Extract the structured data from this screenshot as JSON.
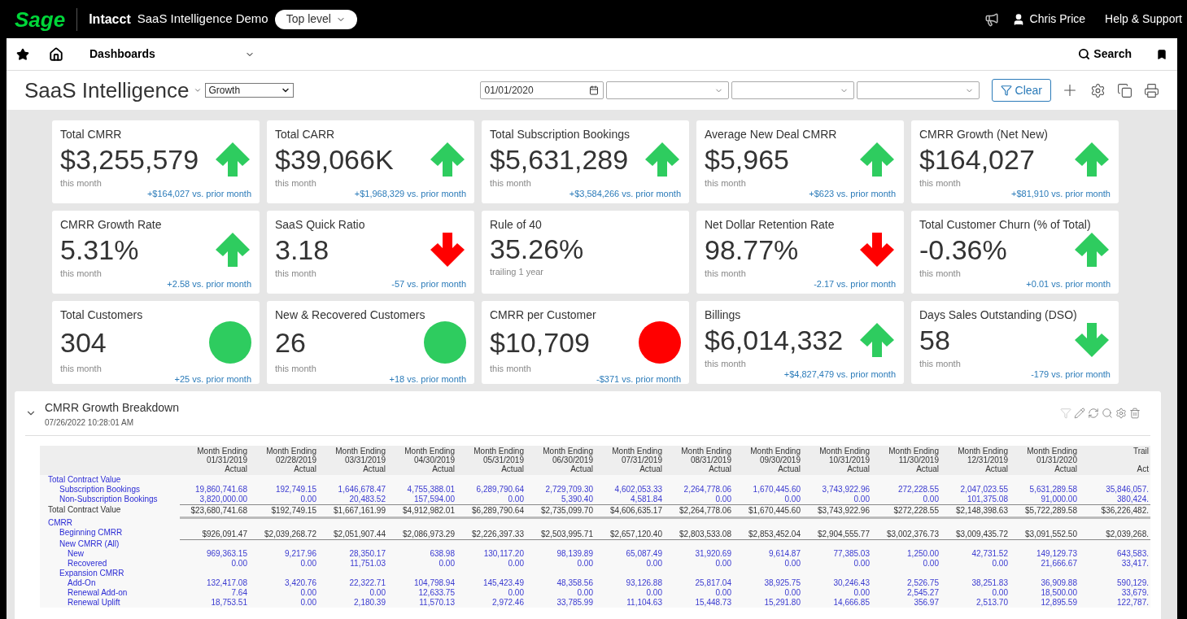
{
  "top_bar": {
    "logo": "Sage",
    "product": "Intacct",
    "company": "SaaS Intelligence Demo",
    "level_button": "Top level",
    "user": "Chris Price",
    "help": "Help & Support"
  },
  "nav": {
    "menu": "Dashboards",
    "search": "Search"
  },
  "title_bar": {
    "title": "SaaS Intelligence",
    "view": "Growth",
    "date": "01/01/2020",
    "clear_button": "Clear"
  },
  "cards": [
    {
      "title": "Total CMRR",
      "value": "$3,255,579",
      "subtitle": "this month",
      "comparison": "+$164,027 vs. prior month",
      "kind": "up",
      "color": "#2ecc5f"
    },
    {
      "title": "Total CARR",
      "value": "$39,066K",
      "subtitle": "this month",
      "comparison": "+$1,968,329 vs. prior month",
      "kind": "up",
      "color": "#2ecc5f"
    },
    {
      "title": "Total Subscription Bookings",
      "value": "$5,631,289",
      "subtitle": "this month",
      "comparison": "+$3,584,266 vs. prior month",
      "kind": "up",
      "color": "#2ecc5f"
    },
    {
      "title": "Average New Deal CMRR",
      "value": "$5,965",
      "subtitle": "this month",
      "comparison": "+$623 vs. prior month",
      "kind": "up",
      "color": "#2ecc5f"
    },
    {
      "title": "CMRR Growth (Net New)",
      "value": "$164,027",
      "subtitle": "this month",
      "comparison": "+$81,910 vs. prior month",
      "kind": "up",
      "color": "#2ecc5f"
    },
    {
      "title": "CMRR Growth Rate",
      "value": "5.31%",
      "subtitle": "this month",
      "comparison": "+2.58 vs. prior month",
      "kind": "up",
      "color": "#2ecc5f"
    },
    {
      "title": "SaaS Quick Ratio",
      "value": "3.18",
      "subtitle": "this month",
      "comparison": "-57 vs. prior month",
      "kind": "down",
      "color": "#ff0000"
    },
    {
      "title": "Rule of 40",
      "value": "35.26%",
      "subtitle": "trailing 1 year"
    },
    {
      "title": "Net Dollar Retention Rate",
      "value": "98.77%",
      "subtitle": "this month",
      "comparison": "-2.17 vs. prior month",
      "kind": "down",
      "color": "#ff0000"
    },
    {
      "title": "Total Customer Churn (% of Total)",
      "value": "-0.36%",
      "subtitle": "this month",
      "comparison": "+0.01 vs. prior month",
      "kind": "up",
      "color": "#2ecc5f"
    },
    {
      "title": "Total Customers",
      "value": "304",
      "subtitle": "this month",
      "comparison": "+25 vs. prior month",
      "kind": "dot",
      "color": "#2ecc5f"
    },
    {
      "title": "New & Recovered Customers",
      "value": "26",
      "subtitle": "this month",
      "comparison": "+18 vs. prior month",
      "kind": "dot",
      "color": "#2ecc5f"
    },
    {
      "title": "CMRR per Customer",
      "value": "$10,709",
      "subtitle": "this month",
      "comparison": "-$371 vs. prior month",
      "kind": "dot",
      "color": "#ff0000"
    },
    {
      "title": "Billings",
      "value": "$6,014,332",
      "subtitle": "this month",
      "comparison": "+$4,827,479 vs. prior month",
      "kind": "up",
      "color": "#2ecc5f"
    },
    {
      "title": "Days Sales Outstanding (DSO)",
      "value": "58",
      "subtitle": "this month",
      "comparison": "-179 vs. prior month",
      "kind": "down",
      "color": "#2ecc5f"
    }
  ],
  "panel": {
    "title": "CMRR Growth Breakdown",
    "timestamp": "07/26/2022 10:28:01 AM",
    "expanded": true,
    "table": {
      "columns": [
        {
          "title": "Month Ending",
          "date": "01/31/2019",
          "type": "Actual"
        },
        {
          "title": "Month Ending",
          "date": "02/28/2019",
          "type": "Actual"
        },
        {
          "title": "Month Ending",
          "date": "03/31/2019",
          "type": "Actual"
        },
        {
          "title": "Month Ending",
          "date": "04/30/2019",
          "type": "Actual"
        },
        {
          "title": "Month Ending",
          "date": "05/31/2019",
          "type": "Actual"
        },
        {
          "title": "Month Ending",
          "date": "06/30/2019",
          "type": "Actual"
        },
        {
          "title": "Month Ending",
          "date": "07/31/2019",
          "type": "Actual"
        },
        {
          "title": "Month Ending",
          "date": "08/31/2019",
          "type": "Actual"
        },
        {
          "title": "Month Ending",
          "date": "09/30/2019",
          "type": "Actual"
        },
        {
          "title": "Month Ending",
          "date": "10/31/2019",
          "type": "Actual"
        },
        {
          "title": "Month Ending",
          "date": "11/30/2019",
          "type": "Actual"
        },
        {
          "title": "Month Ending",
          "date": "12/31/2019",
          "type": "Actual"
        },
        {
          "title": "Month Ending",
          "date": "01/31/2020",
          "type": "Actual"
        },
        {
          "title": "Trail",
          "type": "Act"
        }
      ],
      "rows": [
        {
          "label": "Total Contract Value",
          "kind": "group",
          "children": [
            {
              "label": "Subscription Bookings",
              "kind": "detail",
              "values": [
                "19,860,741.68",
                "192,749.15",
                "1,646,678.47",
                "4,755,388.01",
                "6,289,790.64",
                "2,729,709.30",
                "4,602,053.33",
                "2,264,778.06",
                "1,670,445.60",
                "3,743,922.96",
                "272,228.55",
                "2,047,023.55",
                "5,631,289.58",
                "35,846,057."
              ]
            },
            {
              "label": "Non-Subscription Bookings",
              "kind": "detail",
              "values": [
                "3,820,000.00",
                "0.00",
                "20,483.52",
                "157,594.00",
                "0.00",
                "5,390.40",
                "4,581.84",
                "0.00",
                "0.00",
                "0.00",
                "0.00",
                "101,375.08",
                "91,000.00",
                "380,424."
              ]
            }
          ]
        },
        {
          "label": "Total Contract Value",
          "kind": "total",
          "values": [
            "$23,680,741.68",
            "$192,749.15",
            "$1,667,161.99",
            "$4,912,982.01",
            "$6,289,790.64",
            "$2,735,099.70",
            "$4,606,635.17",
            "$2,264,778.06",
            "$1,670,445.60",
            "$3,743,922.96",
            "$272,228.55",
            "$2,148,398.63",
            "$5,722,289.58",
            "$36,226,482."
          ]
        },
        {
          "label": "CMRR",
          "kind": "group",
          "children": [
            {
              "label": "Beginning CMRR",
              "kind": "subtotal",
              "values": [
                "$926,091.47",
                "$2,039,268.72",
                "$2,051,907.44",
                "$2,086,973.29",
                "$2,226,397.33",
                "$2,503,995.71",
                "$2,657,120.40",
                "$2,803,533.08",
                "$2,853,452.04",
                "$2,904,555.77",
                "$3,002,376.73",
                "$3,009,435.72",
                "$3,091,552.50",
                "$2,039,268."
              ]
            },
            {
              "label": "New CMRR (All)",
              "kind": "group",
              "children": [
                {
                  "label": "New",
                  "kind": "detail",
                  "values": [
                    "969,363.15",
                    "9,217.96",
                    "28,350.17",
                    "638.98",
                    "130,117.20",
                    "98,139.89",
                    "65,087.49",
                    "31,920.69",
                    "9,614.87",
                    "77,385.03",
                    "1,250.00",
                    "42,731.52",
                    "149,129.73",
                    "643,583."
                  ]
                },
                {
                  "label": "Recovered",
                  "kind": "detail",
                  "values": [
                    "0.00",
                    "0.00",
                    "11,751.03",
                    "0.00",
                    "0.00",
                    "0.00",
                    "0.00",
                    "0.00",
                    "0.00",
                    "0.00",
                    "0.00",
                    "0.00",
                    "21,666.67",
                    "33,417."
                  ]
                }
              ]
            },
            {
              "label": "Expansion CMRR",
              "kind": "group",
              "children": [
                {
                  "label": "Add-On",
                  "kind": "detail",
                  "values": [
                    "132,417.08",
                    "3,420.76",
                    "22,322.71",
                    "104,798.94",
                    "145,423.49",
                    "48,358.56",
                    "93,126.88",
                    "25,817.04",
                    "38,925.75",
                    "30,246.43",
                    "2,526.75",
                    "38,251.83",
                    "36,909.88",
                    "590,129."
                  ]
                },
                {
                  "label": "Renewal Add-on",
                  "kind": "detail",
                  "values": [
                    "7.64",
                    "0.00",
                    "0.00",
                    "12,633.75",
                    "0.00",
                    "0.00",
                    "0.00",
                    "0.00",
                    "0.00",
                    "0.00",
                    "2,545.27",
                    "0.00",
                    "18,500.00",
                    "33,679."
                  ]
                },
                {
                  "label": "Renewal Uplift",
                  "kind": "detail",
                  "values": [
                    "18,753.51",
                    "0.00",
                    "2,180.39",
                    "11,570.13",
                    "2,972.46",
                    "33,785.99",
                    "11,104.63",
                    "15,448.73",
                    "15,291.80",
                    "14,666.85",
                    "356.97",
                    "2,513.70",
                    "12,895.59",
                    "122,787."
                  ]
                }
              ]
            }
          ]
        }
      ]
    }
  }
}
